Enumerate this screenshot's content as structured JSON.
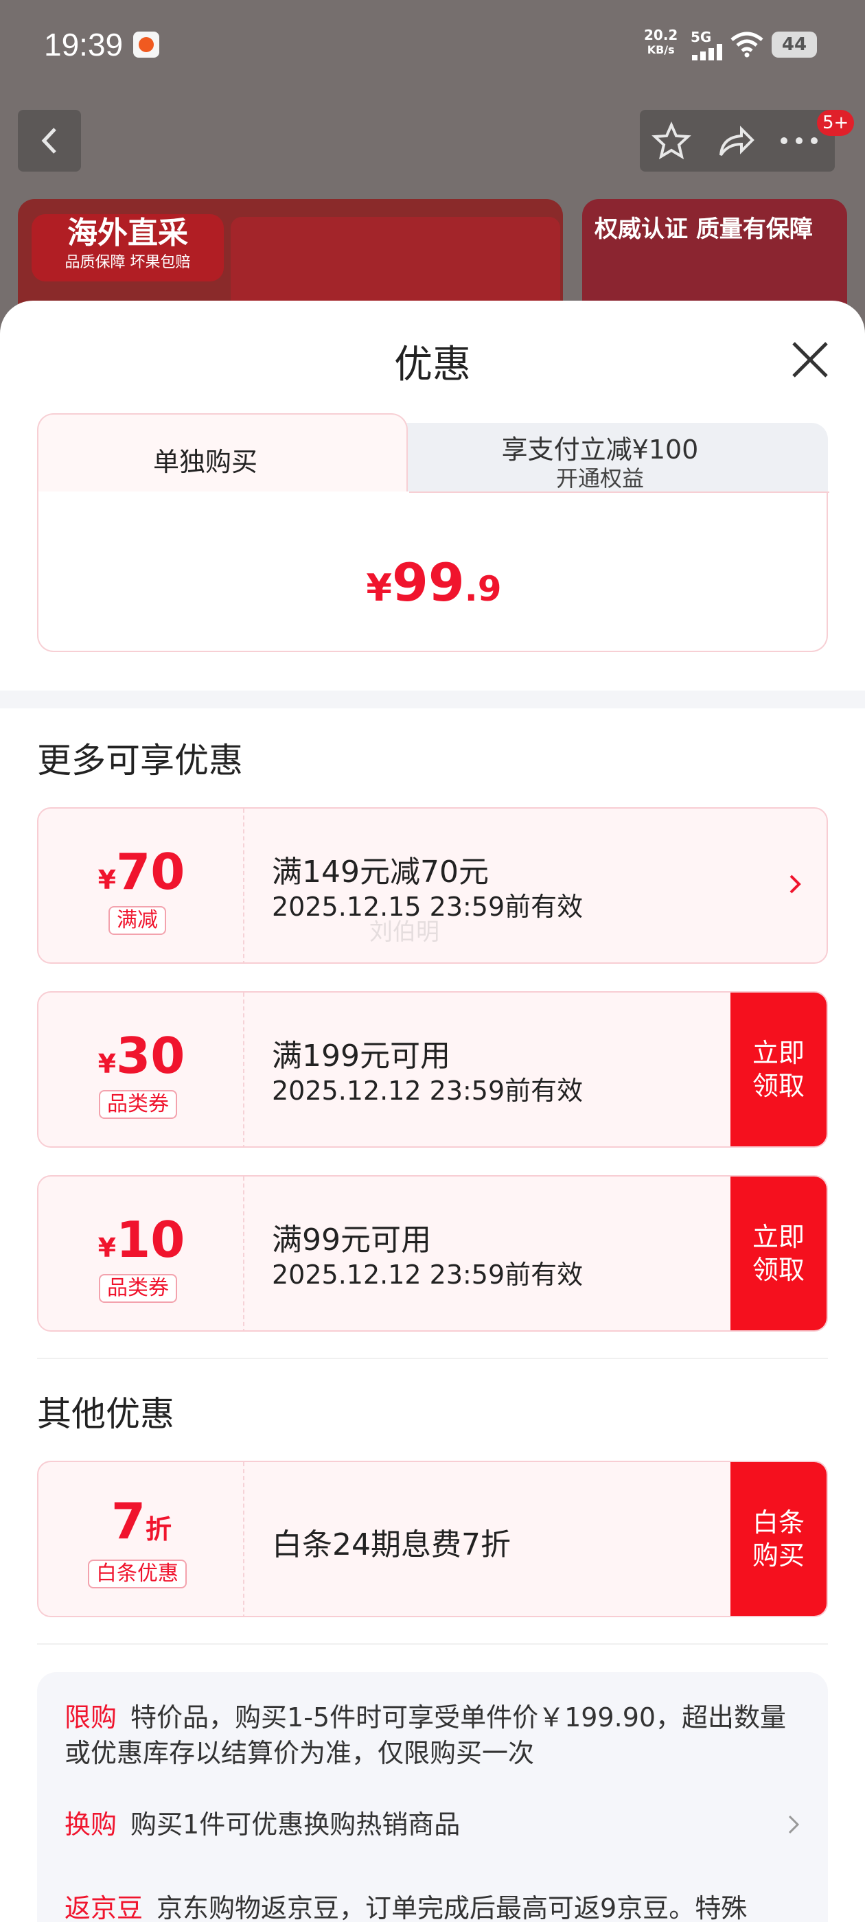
{
  "status_bar": {
    "time": "19:39",
    "net_speed": "20.2",
    "net_unit": "KB/s",
    "network": "5G",
    "battery": "44"
  },
  "header": {
    "notification_badge": "5+"
  },
  "banners": {
    "left_title": "海外直采",
    "left_subtitle": "品质保障 坏果包赔",
    "right_title": "权威认证 质量有保障"
  },
  "sheet": {
    "title": "优惠",
    "tabs": [
      {
        "label": "单独购买",
        "sub": ""
      },
      {
        "label": "享支付立减¥100",
        "sub": "开通权益"
      }
    ],
    "price": {
      "currency": "¥",
      "integer": "99",
      "decimal": ".9"
    }
  },
  "more_offers": {
    "title": "更多可享优惠",
    "coupons": [
      {
        "currency": "¥",
        "amount": "70",
        "tag": "满减",
        "main": "满149元减70元",
        "sub": "2025.12.15 23:59前有效",
        "button": ""
      },
      {
        "currency": "¥",
        "amount": "30",
        "tag": "品类券",
        "main": "满199元可用",
        "sub": "2025.12.12 23:59前有效",
        "button_line1": "立即",
        "button_line2": "领取"
      },
      {
        "currency": "¥",
        "amount": "10",
        "tag": "品类券",
        "main": "满99元可用",
        "sub": "2025.12.12 23:59前有效",
        "button_line1": "立即",
        "button_line2": "领取"
      }
    ]
  },
  "other_offers": {
    "title": "其他优惠",
    "item": {
      "amount": "7",
      "unit": "折",
      "tag": "白条优惠",
      "main": "白条24期息费7折",
      "button_line1": "白条",
      "button_line2": "购买"
    }
  },
  "info": [
    {
      "key": "限购",
      "text": "特价品，购买1-5件时可享受单件价￥199.90，超出数量或优惠库存以结算价为准，仅限购买一次"
    },
    {
      "key": "换购",
      "text": "购买1件可优惠换购热销商品"
    },
    {
      "key": "返京豆",
      "text": "京东购物返京豆，订单完成后最高可返9京豆。特殊"
    }
  ],
  "watermark": "刘伯明"
}
